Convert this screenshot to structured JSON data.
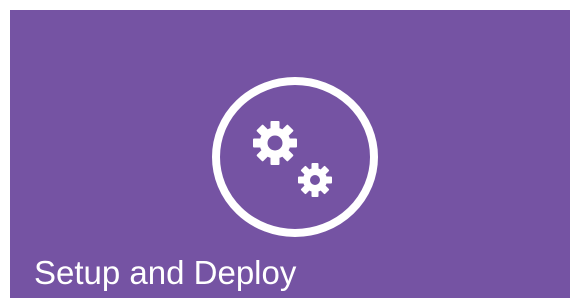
{
  "tile": {
    "label": "Setup and Deploy",
    "icon": "gears-icon",
    "background_color": "#7553a3",
    "foreground_color": "#ffffff"
  }
}
